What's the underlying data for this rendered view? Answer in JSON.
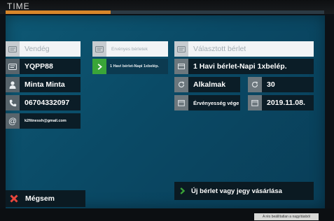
{
  "header": {
    "logo": "TIME",
    "progress_fraction": 0.33
  },
  "customer": {
    "name_placeholder": "Vendég",
    "code": "YQPP88",
    "full_name": "Minta Minta",
    "phone": "06704332097",
    "email": "k2fitnessh@gmail.com"
  },
  "valid_passes": {
    "header": "Érvényes bérletek",
    "items": [
      {
        "label": "1 Havi bérlet-Napi 1xbelép."
      }
    ]
  },
  "selected_pass": {
    "header": "Választott bérlet",
    "name": "1 Havi bérlet-Napi 1xbelép.",
    "occasions_label": "Alkalmak",
    "occasions_value": "30",
    "validity_label": "Érvényesség vége",
    "validity_value": "2019.11.08."
  },
  "actions": {
    "cancel_label": "Mégsem",
    "buy_new_label": "Új bérlet vagy jegy vásárlása"
  },
  "sticker_text": "A rés beállítatlan a nagyításból",
  "colors": {
    "accent_green": "#3aa538",
    "cancel_red": "#e8463c",
    "progress_orange": "#d8862a"
  }
}
